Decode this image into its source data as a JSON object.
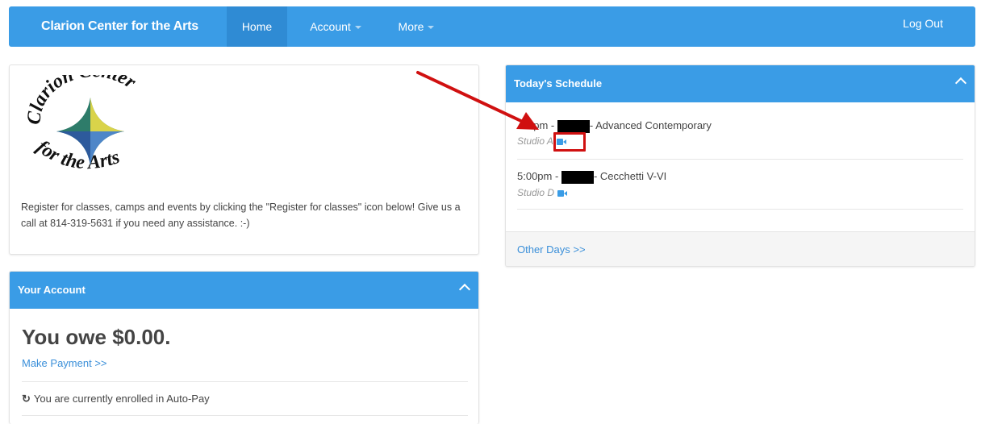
{
  "navbar": {
    "brand": "Clarion Center for the Arts",
    "items": [
      {
        "label": "Home",
        "active": true
      },
      {
        "label": "Account",
        "dropdown": true
      },
      {
        "label": "More",
        "dropdown": true
      }
    ],
    "logout": "Log Out"
  },
  "intro": {
    "logo_text": [
      "Clarion Center",
      "for the Arts"
    ],
    "text": "Register for classes, camps and events by clicking the \"Register for classes\" icon below! Give us a call at 814-319-5631 if you need any assistance. :-)"
  },
  "account": {
    "title": "Your Account",
    "balance_text": "You owe $0.00.",
    "payment_link": "Make Payment >>",
    "autopay_text": "You are currently enrolled in Auto-Pay"
  },
  "schedule": {
    "title": "Today's Schedule",
    "classes": [
      {
        "time": "…0pm -",
        "name": "- Advanced Contemporary",
        "studio": "Studio A"
      },
      {
        "time": "5:00pm -",
        "name": "- Cecchetti V-VI",
        "studio": "Studio D"
      }
    ],
    "other_days": "Other Days >>"
  },
  "colors": {
    "brand_blue": "#3a9ce6",
    "link_blue": "#3a8fd9",
    "annotation_red": "#d01010"
  }
}
